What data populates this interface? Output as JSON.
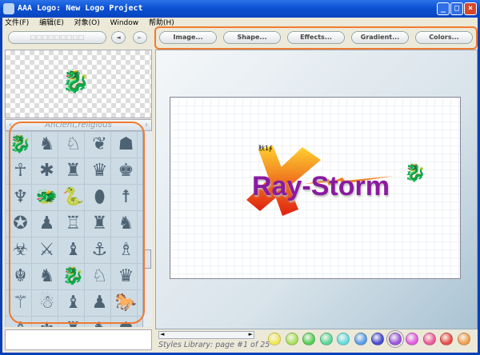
{
  "window": {
    "title": "AAA Logo: New Logo Project",
    "buttons": [
      "_",
      "□",
      "×"
    ]
  },
  "menu": [
    "文件(F)",
    "编辑(E)",
    "对象(O)",
    "Window",
    "帮助(H)"
  ],
  "left_toolbar": {
    "search_placeholder": "□□□□□□□□□",
    "prev": "◄",
    "next": "►"
  },
  "toolbar": {
    "image": "Image...",
    "shape": "Shape...",
    "effects": "Effects...",
    "gradient": "Gradient...",
    "colors": "Colors..."
  },
  "library": {
    "category": "Ancient,religious",
    "prev": "‹",
    "next": "›",
    "symbols": [
      "🐉",
      "♞",
      "♘",
      "❦",
      "☗",
      "☥",
      "✱",
      "♜",
      "♛",
      "♚",
      "♆",
      "🐲",
      "🐍",
      "⬮",
      "☨",
      "✪",
      "♟",
      "♖",
      "♜",
      "♞",
      "☣",
      "⚔",
      "♝",
      "⚓",
      "♗",
      "☬",
      "♞",
      "🐉",
      "♘",
      "♛",
      "⚚",
      "☃",
      "♝",
      "♟",
      "🐎",
      "♗",
      "⚜",
      "♜",
      "♞",
      "☗"
    ]
  },
  "canvas": {
    "logo_text": "Ray-Storm",
    "small_text": "秋1∮",
    "accent": "#8a1aa0"
  },
  "status": {
    "text": "Styles Library: page #1 of 25"
  },
  "swatches": [
    "#f2e85a",
    "#a8e060",
    "#58d058",
    "#5cd69a",
    "#66dce0",
    "#5a9ee8",
    "#4a4ed0",
    "#9a58e0",
    "#e25ee0",
    "#ec5c9a",
    "#e8504a",
    "#f0a050"
  ],
  "selected_swatch": 7
}
